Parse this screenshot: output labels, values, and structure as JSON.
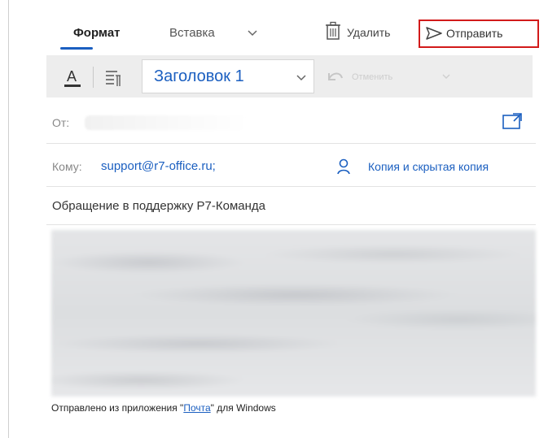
{
  "toolbar": {
    "tab_format": "Формат",
    "tab_insert": "Вставка",
    "delete_label": "Удалить",
    "send_label": "Отправить"
  },
  "ribbon": {
    "style_value": "Заголовок 1",
    "undo_label": "Отменить"
  },
  "from": {
    "label": "От:"
  },
  "to": {
    "label": "Кому:",
    "value": "support@r7-office.ru;",
    "cc_label": "Копия и скрытая копия"
  },
  "subject": {
    "value": "Обращение в поддержку Р7-Команда"
  },
  "signature": {
    "prefix": "Отправлено из приложения \"",
    "app_link": "Почта",
    "suffix": "\" для Windows"
  },
  "colors": {
    "accent": "#1b5fc0",
    "highlight": "#d21a1a"
  }
}
